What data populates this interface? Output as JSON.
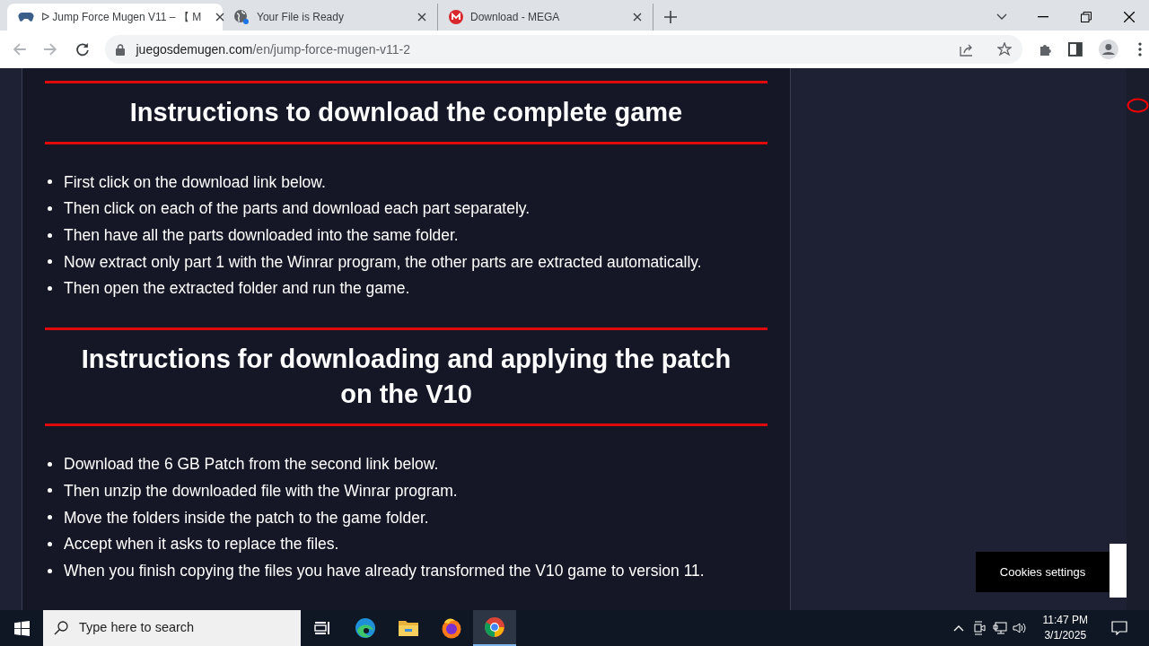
{
  "tabs": [
    {
      "title": "ᐅ Jump Force Mugen V11 – 【 M",
      "selected": true
    },
    {
      "title": "Your File is Ready",
      "selected": false
    },
    {
      "title": "Download - MEGA",
      "selected": false
    }
  ],
  "address": {
    "domain": "juegosdemugen.com",
    "path": "/en/jump-force-mugen-v11-2"
  },
  "sections": [
    {
      "heading": "Instructions to download the complete game",
      "items": [
        "First click on the download link below.",
        "Then click on each of the parts and download each part separately.",
        "Then have all the parts downloaded into the same folder.",
        "Now extract only part 1 with the Winrar program, the other parts are extracted automatically.",
        "Then open the extracted folder and run the game."
      ]
    },
    {
      "heading": "Instructions for downloading and applying the patch on the V10",
      "items": [
        "Download the 6 GB Patch from the second link below.",
        "Then unzip the downloaded file with the Winrar program.",
        "Move the folders inside the patch to the game folder.",
        "Accept when it asks to replace the files.",
        "When you finish copying the files you have already transformed the V10 game to version 11."
      ]
    }
  ],
  "cookies_button": "Cookies settings",
  "taskbar": {
    "search_placeholder": "Type here to search",
    "apps": [
      {
        "kind": "taskview",
        "selected": false
      },
      {
        "kind": "edge",
        "selected": false
      },
      {
        "kind": "folder",
        "selected": false
      },
      {
        "kind": "firefox",
        "selected": false
      },
      {
        "kind": "chrome",
        "selected": true
      }
    ],
    "time": "11:47 PM",
    "date": "3/1/2025"
  }
}
